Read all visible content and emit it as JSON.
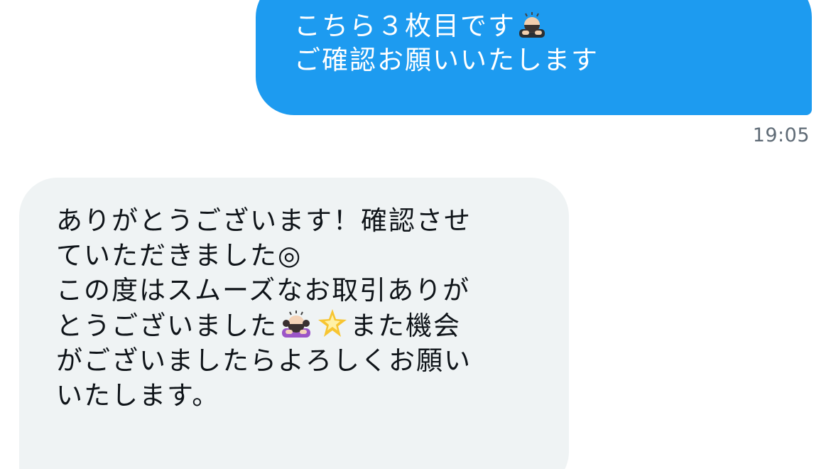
{
  "conversation": {
    "outgoing": {
      "line1": "こちら３枚目です",
      "emoji1": "person-bowing-emoji",
      "line2": "ご確認お願いいたします",
      "time": "19:05"
    },
    "incoming": {
      "line1": "ありがとうございます！確認させ",
      "line2": "ていただきました◎",
      "line3": "この度はスムーズなお取引ありが",
      "line4a": "とうございました",
      "emoji1": "woman-bowing-emoji",
      "emoji2": "glowing-star-emoji",
      "line4b": "また機会",
      "line5": "がございましたらよろしくお願い",
      "line6": "いたします。"
    }
  },
  "colors": {
    "outgoing_bubble": "#1d9bf0",
    "incoming_bubble": "#eff3f4",
    "timestamp": "#5f6b76"
  }
}
